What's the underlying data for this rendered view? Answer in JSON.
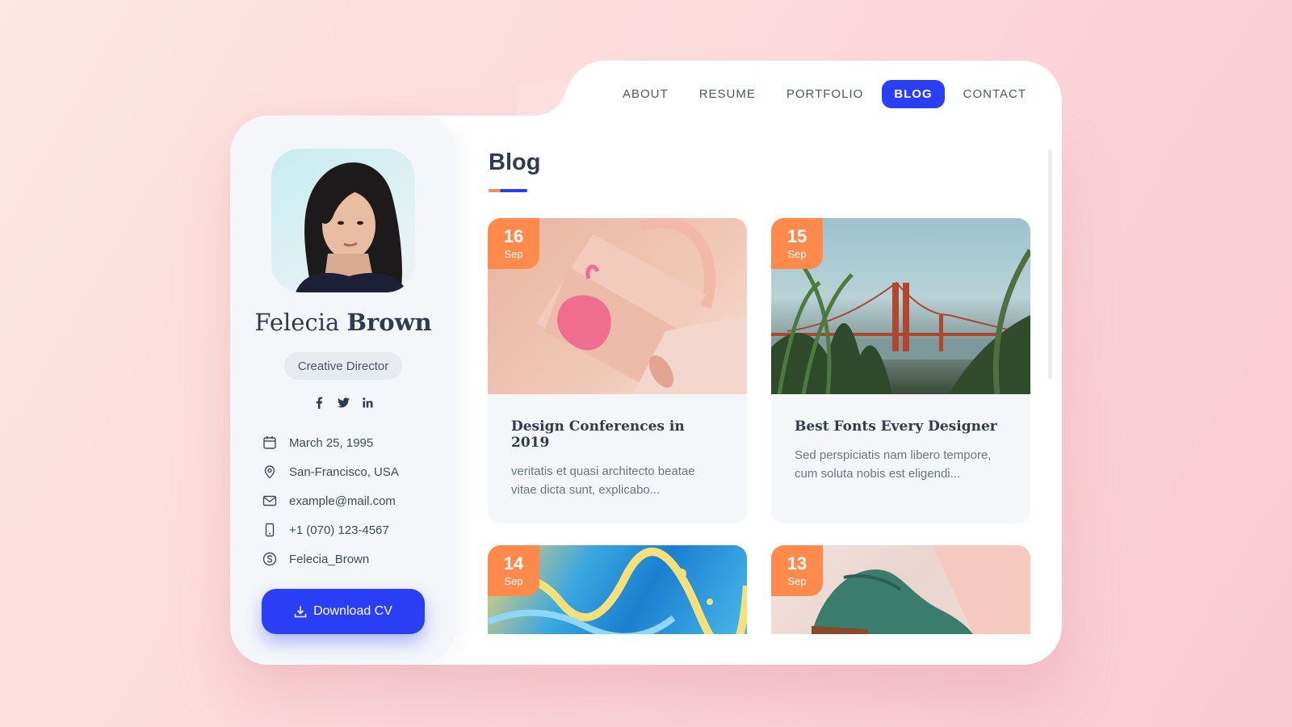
{
  "nav": {
    "items": [
      {
        "label": "ABOUT",
        "active": false
      },
      {
        "label": "RESUME",
        "active": false
      },
      {
        "label": "PORTFOLIO",
        "active": false
      },
      {
        "label": "BLOG",
        "active": true
      },
      {
        "label": "CONTACT",
        "active": false
      }
    ]
  },
  "profile": {
    "first_name": "Felecia",
    "last_name": "Brown",
    "role": "Creative Director",
    "socials": [
      "facebook-icon",
      "twitter-icon",
      "linkedin-icon"
    ],
    "info": [
      {
        "icon": "calendar-icon",
        "text": "March 25, 1995"
      },
      {
        "icon": "location-pin-icon",
        "text": "San-Francisco, USA"
      },
      {
        "icon": "mail-icon",
        "text": "example@mail.com"
      },
      {
        "icon": "phone-icon",
        "text": "+1 (070) 123-4567"
      },
      {
        "icon": "skype-icon",
        "text": "Felecia_Brown"
      }
    ],
    "download_label": "Download CV"
  },
  "blog": {
    "title": "Blog",
    "posts": [
      {
        "day": "16",
        "month": "Sep",
        "title": "Design Conferences in 2019",
        "excerpt": "veritatis et quasi architecto beatae vitae dicta sunt, explicabo..."
      },
      {
        "day": "15",
        "month": "Sep",
        "title": "Best Fonts Every Designer",
        "excerpt": "Sed perspiciatis nam libero tempore, cum soluta nobis est eligendi..."
      },
      {
        "day": "14",
        "month": "Sep",
        "title": "",
        "excerpt": ""
      },
      {
        "day": "13",
        "month": "Sep",
        "title": "",
        "excerpt": ""
      }
    ]
  },
  "colors": {
    "accent": "#2a3ff5",
    "date_badge": "#ff8a4c",
    "text_dark": "#2f3b52"
  }
}
